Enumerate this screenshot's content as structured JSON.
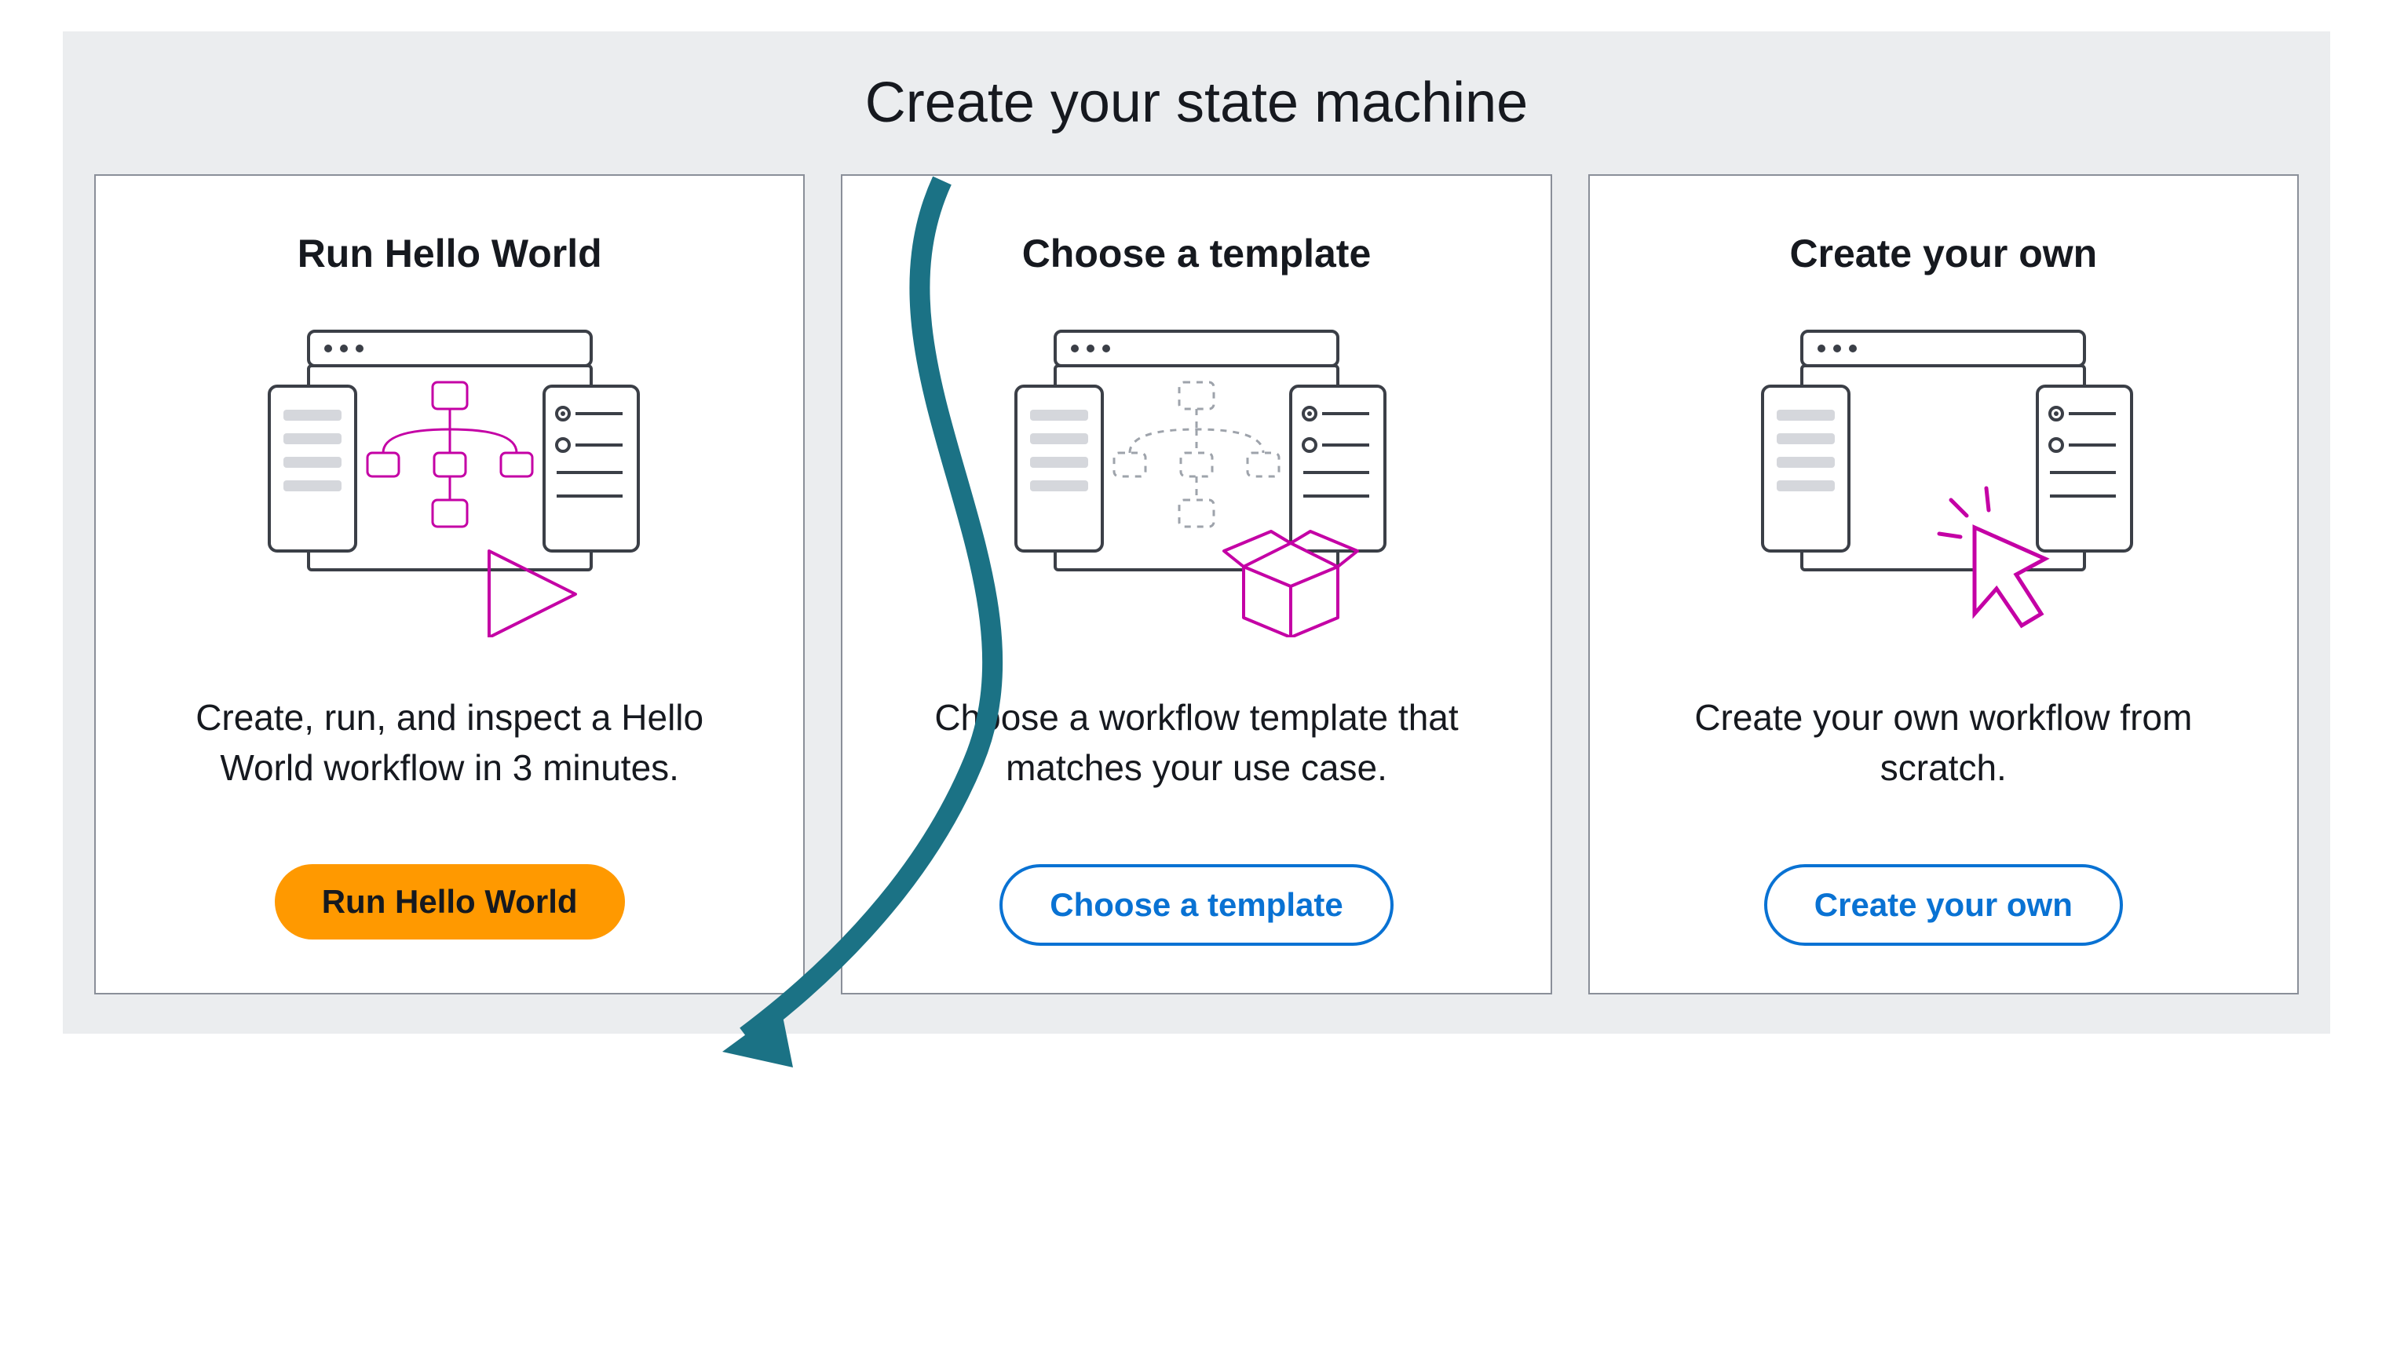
{
  "page": {
    "title": "Create your state machine"
  },
  "cards": [
    {
      "title": "Run Hello World",
      "description": "Create, run, and inspect a Hello World workflow in 3 minutes.",
      "button_label": "Run Hello World",
      "button_style": "primary"
    },
    {
      "title": "Choose a template",
      "description": "Choose a workflow template that matches your use case.",
      "button_label": "Choose a template",
      "button_style": "secondary"
    },
    {
      "title": "Create your own",
      "description": "Create your own workflow from scratch.",
      "button_label": "Create your own",
      "button_style": "secondary"
    }
  ]
}
